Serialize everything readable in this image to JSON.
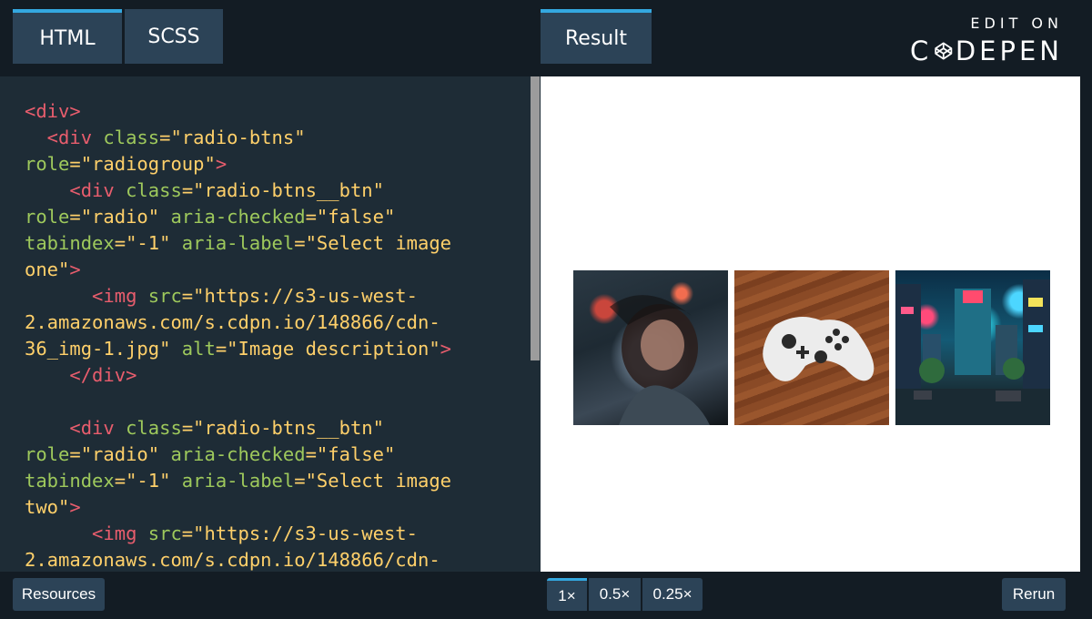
{
  "tabs": {
    "html": "HTML",
    "scss": "SCSS",
    "result": "Result"
  },
  "brand": {
    "edit_on": "EDIT ON",
    "logo_pre": "C",
    "logo_post": "DEPEN"
  },
  "code": {
    "l1_tag": "<div>",
    "l2_open": "  <div ",
    "l2_attr": "class",
    "l2_eq": "=",
    "l2_val": "\"radio-btns\"",
    "l3_attr": "role",
    "l3_eq": "=",
    "l3_val": "\"radiogroup\"",
    "l3_close": ">",
    "l4_open": "    <div ",
    "l4_attr": "class",
    "l4_eq": "=",
    "l4_val": "\"radio-btns__btn\"",
    "l5_attr1": "role",
    "l5_val1": "=\"radio\"",
    "l5_attr2": " aria-checked",
    "l5_val2": "=\"false\"",
    "l6_attr1": "tabindex",
    "l6_val1": "=\"-1\"",
    "l6_attr2": " aria-label",
    "l6_val2": "=\"Select image",
    "l7_val": "one\"",
    "l7_close": ">",
    "l8_open": "      <img ",
    "l8_attr": "src",
    "l8_val": "=\"https://s3-us-west-",
    "l9_val": "2.amazonaws.com/s.cdpn.io/148866/cdn-",
    "l10_val": "36_img-1.jpg\"",
    "l10_attr": " alt",
    "l10_val2": "=\"Image description\"",
    "l10_close": ">",
    "l11_tag": "    </div>",
    "l13_open": "    <div ",
    "l13_attr": "class",
    "l13_eq": "=",
    "l13_val": "\"radio-btns__btn\"",
    "l14_attr1": "role",
    "l14_val1": "=\"radio\"",
    "l14_attr2": " aria-checked",
    "l14_val2": "=\"false\"",
    "l15_attr1": "tabindex",
    "l15_val1": "=\"-1\"",
    "l15_attr2": " aria-label",
    "l15_val2": "=\"Select image",
    "l16_val": "two\"",
    "l16_close": ">",
    "l17_open": "      <img ",
    "l17_attr": "src",
    "l17_val": "=\"https://s3-us-west-",
    "l18_val": "2.amazonaws.com/s.cdpn.io/148866/cdn-"
  },
  "photos": [
    "woman-in-neon-city-photo",
    "game-controller-photo",
    "neon-street-photo"
  ],
  "bottom": {
    "resources": "Resources",
    "zoom": [
      "1×",
      "0.5×",
      "0.25×"
    ],
    "rerun": "Rerun"
  },
  "colors": {
    "accent": "#34a8e0",
    "tab_bg": "#2c4357",
    "bar_bg": "#131c24",
    "editor_bg": "#1e2c36",
    "tag": "#e85d6d",
    "attr": "#9ec95c",
    "string": "#ffd06a"
  }
}
